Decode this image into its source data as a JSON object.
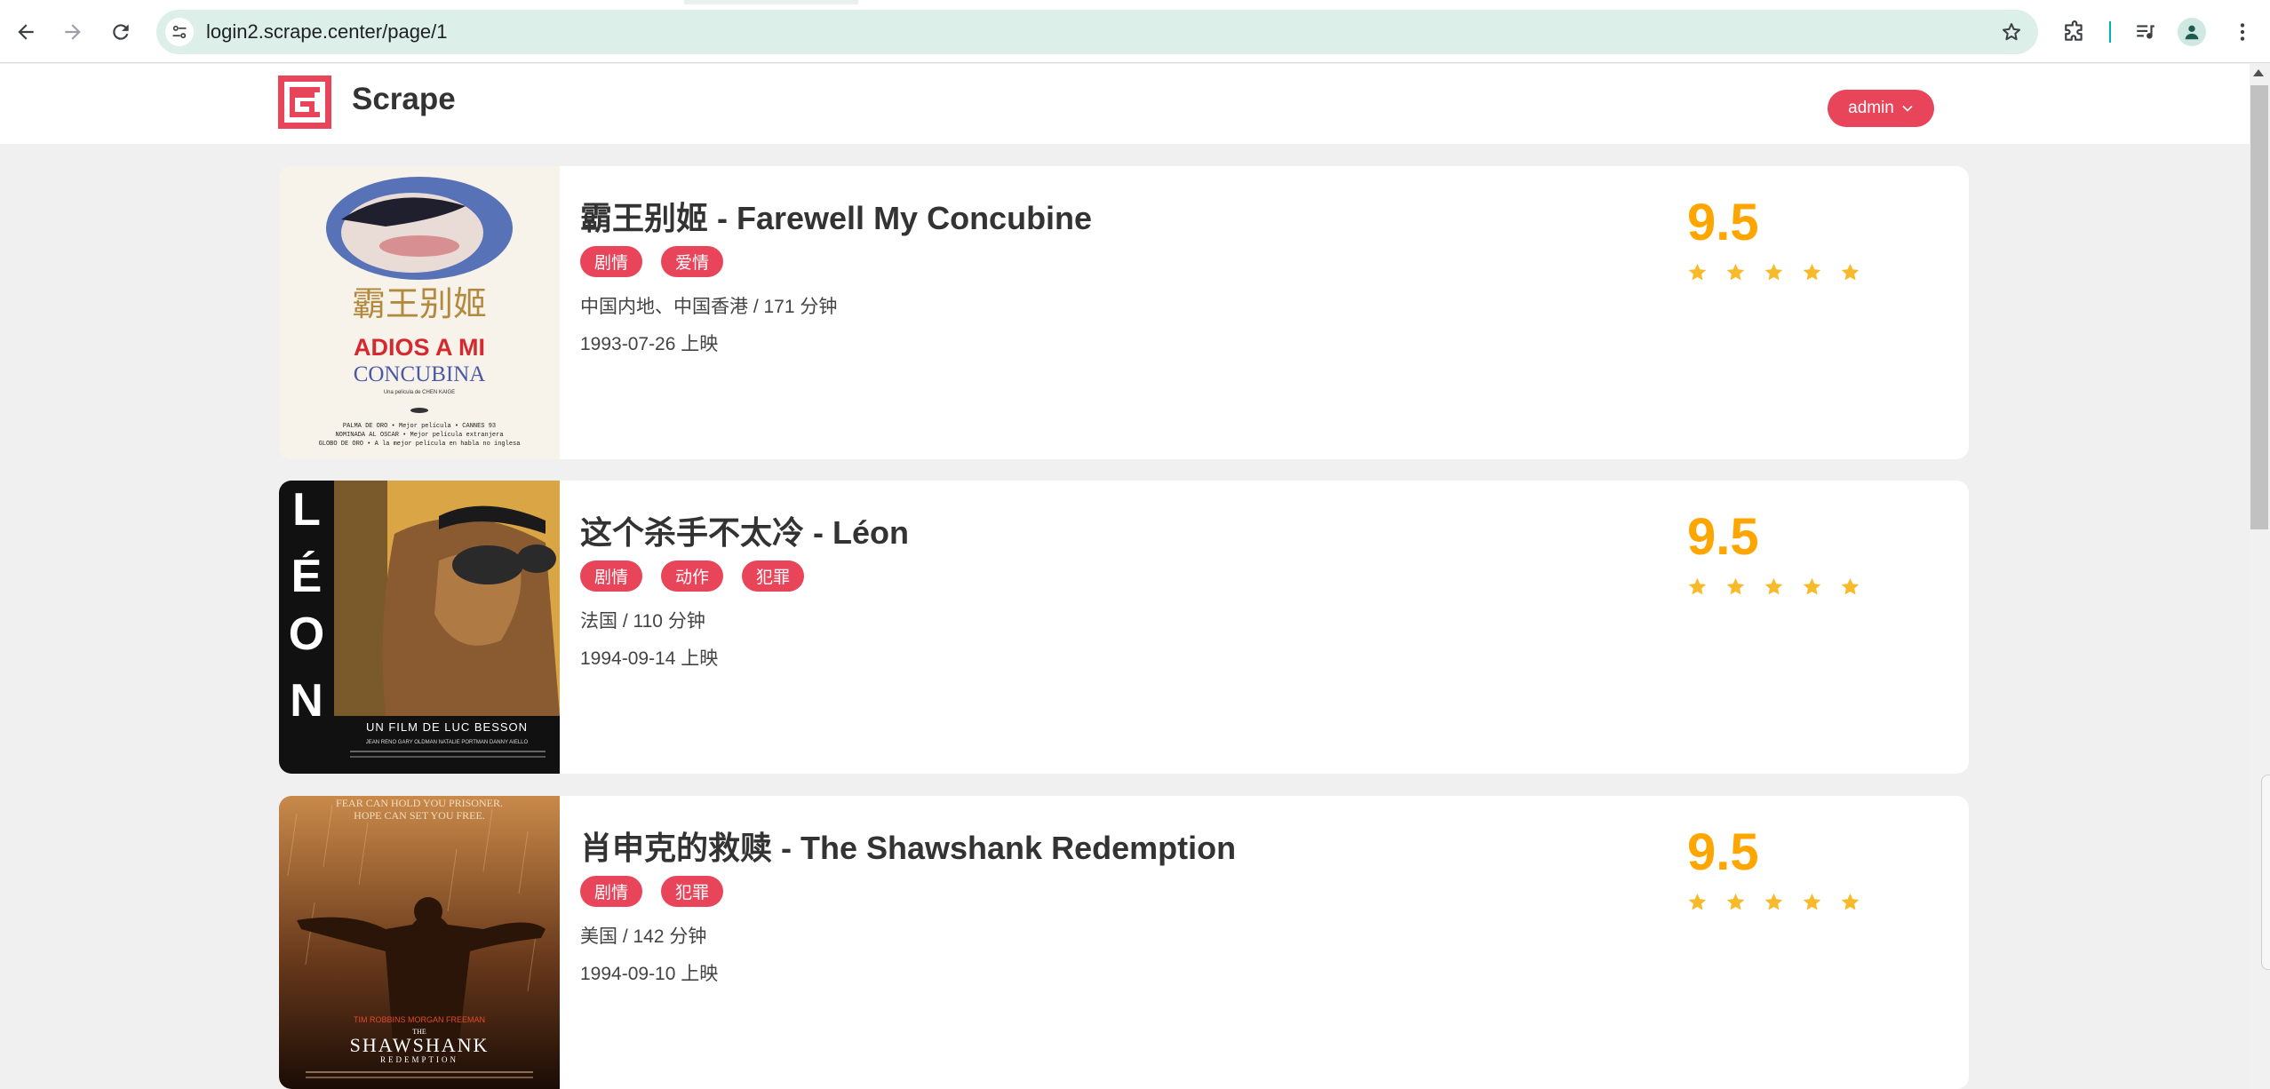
{
  "browser": {
    "url": "login2.scrape.center/page/1"
  },
  "header": {
    "logo_text": "Scrape",
    "user_menu_label": "admin"
  },
  "colors": {
    "accent": "#e8445a",
    "score": "#ffa500",
    "page_background": "#f0f0f0"
  },
  "movies": [
    {
      "title": "霸王别姬 - Farewell My Concubine",
      "tags": [
        "剧情",
        "爱情"
      ],
      "info": "中国内地、中国香港 / 171 分钟",
      "release": "1993-07-26 上映",
      "score": "9.5",
      "stars": 5,
      "poster_text": [
        "霸王别姬",
        "ADIOS A MI",
        "CONCUBINA",
        "Una película de CHEN KAIGE",
        "PALMA DE ORO • Mejor película • CANNES 93",
        "NOMINADA AL OSCAR • Mejor película extranjera",
        "GLOBO DE ORO • A la mejor película en habla no inglesa"
      ]
    },
    {
      "title": "这个杀手不太冷 - Léon",
      "tags": [
        "剧情",
        "动作",
        "犯罪"
      ],
      "info": "法国 / 110 分钟",
      "release": "1994-09-14 上映",
      "score": "9.5",
      "stars": 5,
      "poster_text": [
        "LÉON",
        "UN FILM DE LUC BESSON",
        "JEAN RENO   GARY OLDMAN   NATALIE PORTMAN   DANNY AIELLO"
      ]
    },
    {
      "title": "肖申克的救赎 - The Shawshank Redemption",
      "tags": [
        "剧情",
        "犯罪"
      ],
      "info": "美国 / 142 分钟",
      "release": "1994-09-10 上映",
      "score": "9.5",
      "stars": 5,
      "poster_text": [
        "FEAR CAN HOLD YOU PRISONER.",
        "HOPE CAN SET YOU FREE.",
        "TIM ROBBINS    MORGAN FREEMAN",
        "THE",
        "SHAWSHANK",
        "REDEMPTION"
      ]
    }
  ]
}
